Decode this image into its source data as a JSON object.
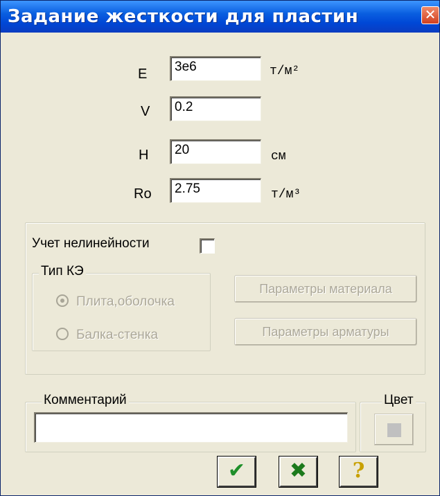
{
  "window": {
    "title": "Задание жесткости для пластин",
    "close_glyph": "✕"
  },
  "params": {
    "E": {
      "label": "E",
      "value": "3e6",
      "unit": "т/м²"
    },
    "V": {
      "label": "V",
      "value": "0.2",
      "unit": ""
    },
    "H": {
      "label": "H",
      "value": "20",
      "unit": "см"
    },
    "Ro": {
      "label": "Ro",
      "value": "2.75",
      "unit": "т/м³"
    }
  },
  "nonlinearity": {
    "label": "Учет нелинейности",
    "checked": false,
    "fe_type_group": "Тип КЭ",
    "options": [
      {
        "label": "Плита,оболочка",
        "selected": true
      },
      {
        "label": "Балка-стенка",
        "selected": false
      }
    ],
    "material_button": "Параметры материала",
    "reinforcement_button": "Параметры арматуры"
  },
  "comment": {
    "label": "Комментарий",
    "value": ""
  },
  "color": {
    "label": "Цвет",
    "swatch": "#c0c0c0"
  },
  "actions": {
    "ok_icon": "checkmark-icon",
    "ok_glyph": "✔",
    "ok_color": "#1f8f2a",
    "cancel_icon": "x-icon",
    "cancel_glyph": "✖",
    "cancel_color": "#1c7a1c",
    "help_icon": "question-icon",
    "help_glyph": "?",
    "help_color": "#c8a000"
  }
}
